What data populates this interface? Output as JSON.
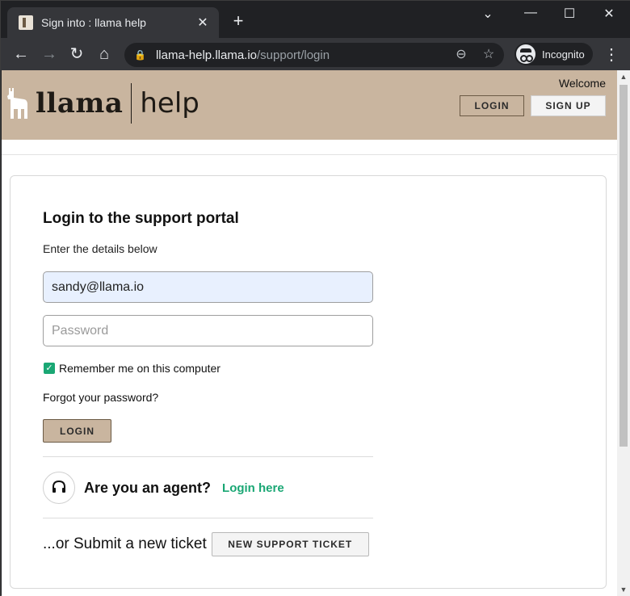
{
  "browser": {
    "tab_title": "Sign into : llama help",
    "tab_close": "✕",
    "new_tab": "+",
    "window_controls": {
      "chevron": "⌄",
      "minimize": "—",
      "maximize": "☐",
      "close": "✕"
    },
    "nav": {
      "back": "←",
      "forward": "→",
      "reload": "↻",
      "home": "⌂"
    },
    "url_host": "llama-help.llama.io",
    "url_path": "/support/login",
    "lock_icon": "🔒",
    "zoom_icon": "⊖",
    "star_icon": "☆",
    "incognito_label": "Incognito",
    "menu": "⋮"
  },
  "header": {
    "logo_word": "llama",
    "logo_help": "help",
    "welcome": "Welcome",
    "login_label": "LOGIN",
    "signup_label": "SIGN UP",
    "background_color": "#c9b59f"
  },
  "login_form": {
    "title": "Login to the support portal",
    "subtitle": "Enter the details below",
    "email_value": "sandy@llama.io",
    "password_placeholder": "Password",
    "remember_label": "Remember me on this computer",
    "remember_checked": true,
    "check_glyph": "✓",
    "forgot_label": "Forgot your password?",
    "login_label": "LOGIN"
  },
  "agent": {
    "question": "Are you an agent?",
    "link_label": "Login here",
    "link_color": "#1aa774"
  },
  "ticket": {
    "text": "...or Submit a new ticket",
    "button_label": "NEW SUPPORT TICKET"
  },
  "scrollbar": {
    "up": "▲",
    "down": "▼"
  }
}
